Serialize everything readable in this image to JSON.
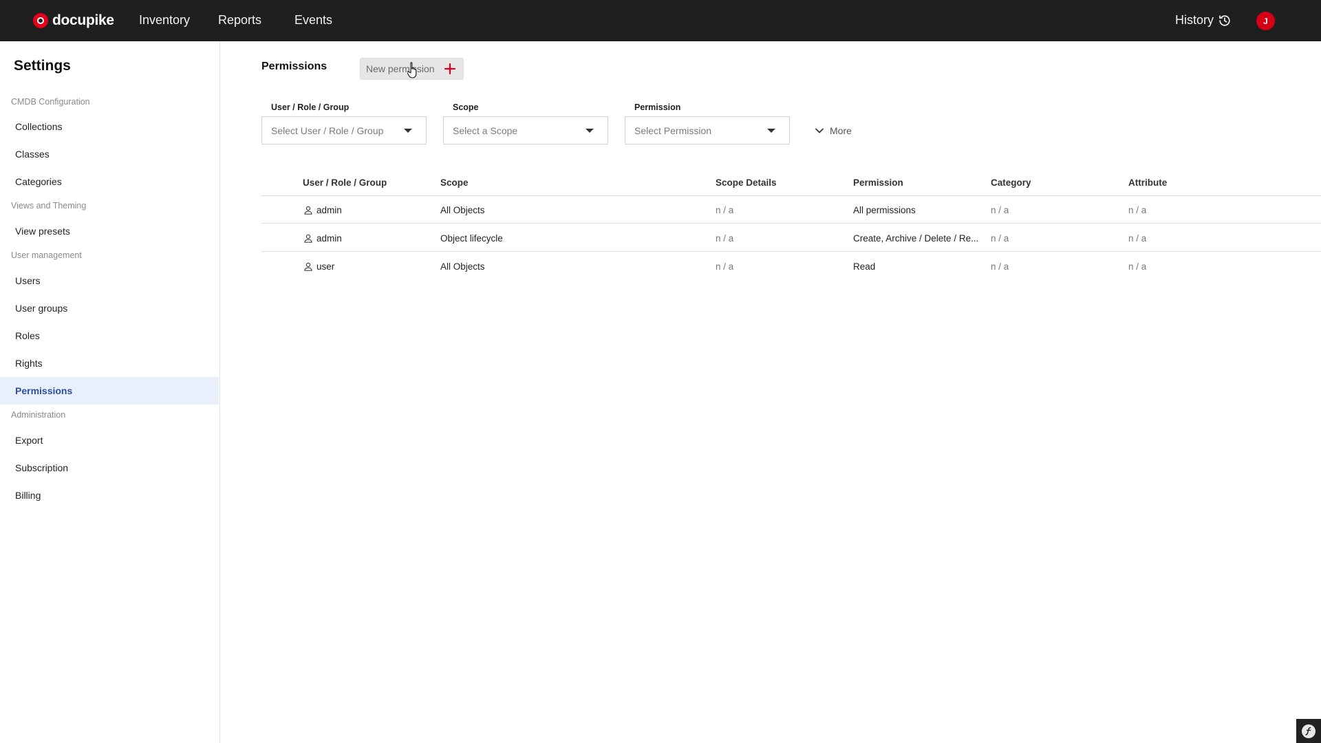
{
  "topbar": {
    "brand": "docupike",
    "nav": [
      {
        "label": "Inventory"
      },
      {
        "label": "Reports"
      },
      {
        "label": "Events"
      }
    ],
    "history_label": "History",
    "avatar_initial": "J",
    "accent_color": "#e3001b"
  },
  "sidebar": {
    "title": "Settings",
    "groups": [
      {
        "label": "CMDB Configuration",
        "items": [
          "Collections",
          "Classes",
          "Categories"
        ]
      },
      {
        "label": "Views and Theming",
        "items": [
          "View presets"
        ]
      },
      {
        "label": "User management",
        "items": [
          "Users",
          "User groups",
          "Roles",
          "Rights",
          "Permissions"
        ]
      },
      {
        "label": "Administration",
        "items": [
          "Export",
          "Subscription",
          "Billing"
        ]
      }
    ],
    "active_item": "Permissions"
  },
  "main": {
    "title": "Permissions",
    "new_button_label": "New permission",
    "filters": [
      {
        "label": "User / Role / Group",
        "placeholder": "Select User / Role / Group"
      },
      {
        "label": "Scope",
        "placeholder": "Select a Scope"
      },
      {
        "label": "Permission",
        "placeholder": "Select Permission"
      }
    ],
    "more_label": "More"
  },
  "table": {
    "columns": [
      "User / Role / Group",
      "Scope",
      "Scope Details",
      "Permission",
      "Category",
      "Attribute"
    ],
    "rows": [
      {
        "subject": "admin",
        "scope": "All Objects",
        "scope_details": "n / a",
        "permission": "All permissions",
        "category": "n / a",
        "attribute": "n / a"
      },
      {
        "subject": "admin",
        "scope": "Object lifecycle",
        "scope_details": "n / a",
        "permission": "Create, Archive / Delete / Re...",
        "category": "n / a",
        "attribute": "n / a"
      },
      {
        "subject": "user",
        "scope": "All Objects",
        "scope_details": "n / a",
        "permission": "Read",
        "category": "n / a",
        "attribute": "n / a"
      }
    ]
  }
}
